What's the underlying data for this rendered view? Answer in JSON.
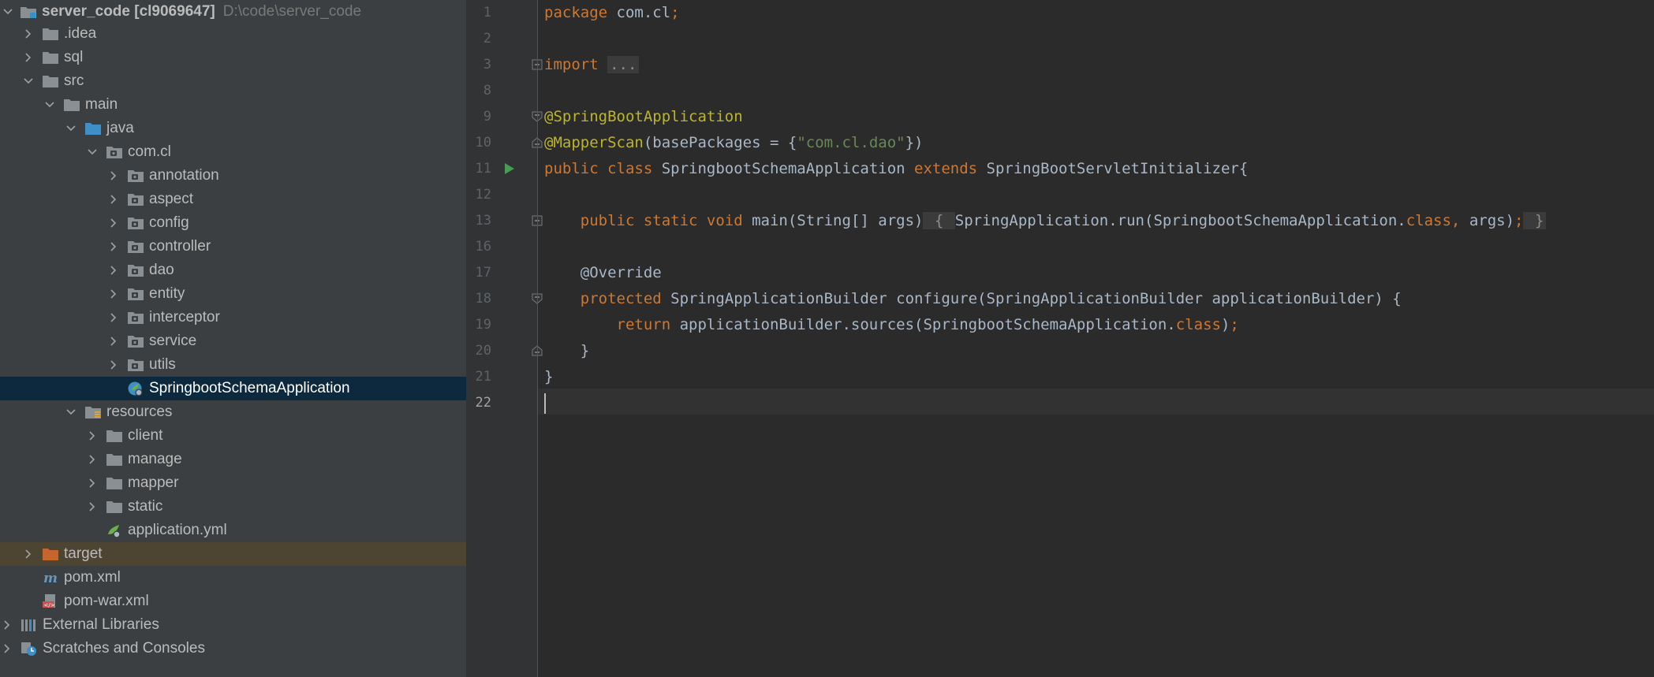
{
  "project_tree": {
    "root": {
      "name": "server_code [cl9069647]",
      "path": "D:\\code\\server_code"
    },
    "rows": [
      {
        "label": ".idea",
        "depth": 1,
        "chevron": "right",
        "icon": "folder-icon"
      },
      {
        "label": "sql",
        "depth": 1,
        "chevron": "right",
        "icon": "folder-icon"
      },
      {
        "label": "src",
        "depth": 1,
        "chevron": "down",
        "icon": "folder-icon"
      },
      {
        "label": "main",
        "depth": 2,
        "chevron": "down",
        "icon": "folder-icon"
      },
      {
        "label": "java",
        "depth": 3,
        "chevron": "down",
        "icon": "source-folder-icon"
      },
      {
        "label": "com.cl",
        "depth": 4,
        "chevron": "down",
        "icon": "package-icon"
      },
      {
        "label": "annotation",
        "depth": 5,
        "chevron": "right",
        "icon": "package-icon"
      },
      {
        "label": "aspect",
        "depth": 5,
        "chevron": "right",
        "icon": "package-icon"
      },
      {
        "label": "config",
        "depth": 5,
        "chevron": "right",
        "icon": "package-icon"
      },
      {
        "label": "controller",
        "depth": 5,
        "chevron": "right",
        "icon": "package-icon"
      },
      {
        "label": "dao",
        "depth": 5,
        "chevron": "right",
        "icon": "package-icon"
      },
      {
        "label": "entity",
        "depth": 5,
        "chevron": "right",
        "icon": "package-icon"
      },
      {
        "label": "interceptor",
        "depth": 5,
        "chevron": "right",
        "icon": "package-icon"
      },
      {
        "label": "service",
        "depth": 5,
        "chevron": "right",
        "icon": "package-icon"
      },
      {
        "label": "utils",
        "depth": 5,
        "chevron": "right",
        "icon": "package-icon"
      },
      {
        "label": "SpringbootSchemaApplication",
        "depth": 5,
        "chevron": "none",
        "icon": "spring-boot-class-icon",
        "selected": true
      },
      {
        "label": "resources",
        "depth": 3,
        "chevron": "down",
        "icon": "resources-folder-icon"
      },
      {
        "label": "client",
        "depth": 4,
        "chevron": "right",
        "icon": "folder-icon"
      },
      {
        "label": "manage",
        "depth": 4,
        "chevron": "right",
        "icon": "folder-icon"
      },
      {
        "label": "mapper",
        "depth": 4,
        "chevron": "right",
        "icon": "folder-icon"
      },
      {
        "label": "static",
        "depth": 4,
        "chevron": "right",
        "icon": "folder-icon"
      },
      {
        "label": "application.yml",
        "depth": 4,
        "chevron": "none",
        "icon": "spring-yml-icon"
      },
      {
        "label": "target",
        "depth": 1,
        "chevron": "right",
        "icon": "excluded-folder-icon",
        "excluded": true
      },
      {
        "label": "pom.xml",
        "depth": 1,
        "chevron": "none",
        "icon": "maven-icon"
      },
      {
        "label": "pom-war.xml",
        "depth": 1,
        "chevron": "none",
        "icon": "xml-icon"
      },
      {
        "label": "External Libraries",
        "depth": 0,
        "chevron": "right",
        "icon": "libraries-icon"
      },
      {
        "label": "Scratches and Consoles",
        "depth": 0,
        "chevron": "right",
        "icon": "scratches-icon"
      }
    ]
  },
  "editor": {
    "current_line": "22",
    "lines": [
      {
        "num": "1",
        "tokens": [
          {
            "t": "package ",
            "c": "kw"
          },
          {
            "t": "com.cl",
            "c": ""
          },
          {
            "t": ";",
            "c": "kw"
          }
        ]
      },
      {
        "num": "2",
        "tokens": []
      },
      {
        "num": "3",
        "fold": "plus",
        "tokens": [
          {
            "t": "import ",
            "c": "kw"
          },
          {
            "t": "...",
            "c": "fold-box"
          }
        ]
      },
      {
        "num": "8",
        "tokens": []
      },
      {
        "num": "9",
        "fold": "open",
        "tokens": [
          {
            "t": "@SpringBootApplication",
            "c": "ann"
          }
        ]
      },
      {
        "num": "10",
        "fold": "close",
        "tokens": [
          {
            "t": "@MapperScan",
            "c": "ann"
          },
          {
            "t": "(basePackages = {",
            "c": ""
          },
          {
            "t": "\"com.cl.dao\"",
            "c": "str"
          },
          {
            "t": "})",
            "c": ""
          }
        ]
      },
      {
        "num": "11",
        "run": true,
        "tokens": [
          {
            "t": "public class ",
            "c": "kw"
          },
          {
            "t": "SpringbootSchemaApplication ",
            "c": ""
          },
          {
            "t": "extends ",
            "c": "kw"
          },
          {
            "t": "SpringBootServletInitializer{",
            "c": ""
          }
        ]
      },
      {
        "num": "12",
        "tokens": []
      },
      {
        "num": "13",
        "fold": "plus",
        "tokens": [
          {
            "t": "    ",
            "c": ""
          },
          {
            "t": "public static void ",
            "c": "kw"
          },
          {
            "t": "main(String[] args)",
            "c": ""
          },
          {
            "t": " { ",
            "c": "fold-box"
          },
          {
            "t": "SpringApplication.run(SpringbootSchemaApplication.",
            "c": ""
          },
          {
            "t": "class, ",
            "c": "kw"
          },
          {
            "t": "args)",
            "c": ""
          },
          {
            "t": ";",
            "c": "kw"
          },
          {
            "t": " }",
            "c": "fold-box"
          }
        ]
      },
      {
        "num": "16",
        "tokens": []
      },
      {
        "num": "17",
        "tokens": [
          {
            "t": "    @Override",
            "c": ""
          }
        ]
      },
      {
        "num": "18",
        "fold": "open",
        "tokens": [
          {
            "t": "    ",
            "c": ""
          },
          {
            "t": "protected ",
            "c": "kw"
          },
          {
            "t": "SpringApplicationBuilder configure(SpringApplicationBuilder applicationBuilder) {",
            "c": ""
          }
        ]
      },
      {
        "num": "19",
        "tokens": [
          {
            "t": "        ",
            "c": ""
          },
          {
            "t": "return ",
            "c": "kw"
          },
          {
            "t": "applicationBuilder.sources(SpringbootSchemaApplication.",
            "c": ""
          },
          {
            "t": "class",
            "c": "kw"
          },
          {
            "t": ")",
            "c": ""
          },
          {
            "t": ";",
            "c": "kw"
          }
        ]
      },
      {
        "num": "20",
        "fold": "close",
        "tokens": [
          {
            "t": "    }",
            "c": ""
          }
        ]
      },
      {
        "num": "21",
        "tokens": [
          {
            "t": "}",
            "c": ""
          }
        ]
      },
      {
        "num": "22",
        "caret": true,
        "tokens": []
      }
    ]
  },
  "colors": {
    "keyword": "#cc7832",
    "annotation": "#bbb529",
    "string": "#6a8759",
    "selection": "#0d293e"
  }
}
